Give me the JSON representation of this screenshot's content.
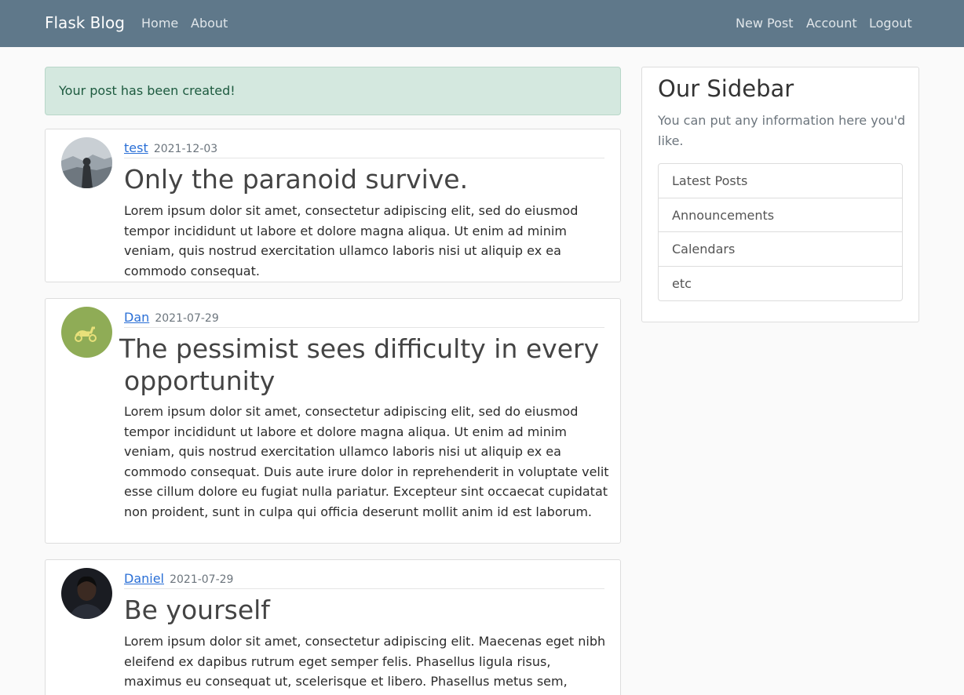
{
  "navbar": {
    "brand": "Flask Blog",
    "left_links": [
      {
        "label": "Home"
      },
      {
        "label": "About"
      }
    ],
    "right_links": [
      {
        "label": "New Post"
      },
      {
        "label": "Account"
      },
      {
        "label": "Logout"
      }
    ]
  },
  "alert": {
    "message": "Your post has been created!"
  },
  "posts": [
    {
      "author": "test",
      "date": "2021-12-03",
      "title": "Only the paranoid survive.",
      "content": "Lorem ipsum dolor sit amet, consectetur adipiscing elit, sed do eiusmod tempor incididunt ut labore et dolore magna aliqua. Ut enim ad minim veniam, quis nostrud exercitation ullamco laboris nisi ut aliquip ex ea commodo consequat."
    },
    {
      "author": "Dan",
      "date": "2021-07-29",
      "title": "The pessimist sees difficulty in every opportunity",
      "content": "Lorem ipsum dolor sit amet, consectetur adipiscing elit, sed do eiusmod tempor incididunt ut labore et dolore magna aliqua. Ut enim ad minim veniam, quis nostrud exercitation ullamco laboris nisi ut aliquip ex ea commodo consequat. Duis aute irure dolor in reprehenderit in voluptate velit esse cillum dolore eu fugiat nulla pariatur. Excepteur sint occaecat cupidatat non proident, sunt in culpa qui officia deserunt mollit anim id est laborum."
    },
    {
      "author": "Daniel",
      "date": "2021-07-29",
      "title": "Be yourself",
      "content": "Lorem ipsum dolor sit amet, consectetur adipiscing elit. Maecenas eget nibh eleifend ex dapibus rutrum eget semper felis. Phasellus ligula risus, maximus eu consequat ut, scelerisque et libero. Phasellus metus sem, convallis quis"
    }
  ],
  "sidebar": {
    "title": "Our Sidebar",
    "text": "You can put any information here you'd like.",
    "items": [
      {
        "label": "Latest Posts"
      },
      {
        "label": "Announcements"
      },
      {
        "label": "Calendars"
      },
      {
        "label": "etc"
      }
    ]
  },
  "colors": {
    "navbar": "#5f788a",
    "alert_bg": "#d4e8df",
    "author_link": "#2a6fd6"
  }
}
